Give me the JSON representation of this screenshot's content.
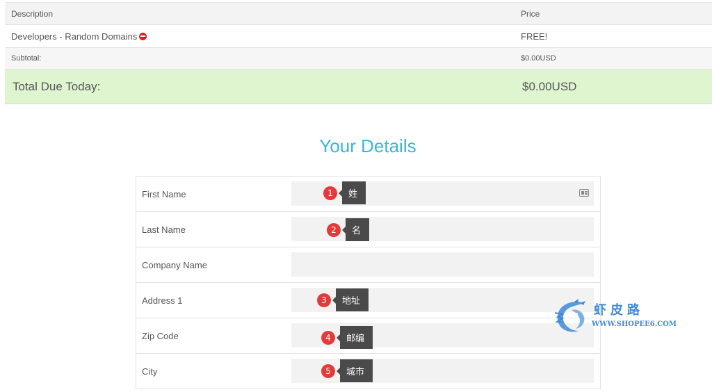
{
  "summary": {
    "headers": {
      "description": "Description",
      "price": "Price"
    },
    "item": {
      "description": "Developers - Random Domains",
      "price": "FREE!"
    },
    "subtotal": {
      "label": "Subtotal:",
      "value": "$0.00USD"
    },
    "total": {
      "label": "Total Due Today:",
      "value": "$0.00USD"
    }
  },
  "details": {
    "title": "Your Details",
    "fields": [
      {
        "label": "First Name",
        "value": ""
      },
      {
        "label": "Last Name",
        "value": ""
      },
      {
        "label": "Company Name",
        "value": ""
      },
      {
        "label": "Address 1",
        "value": ""
      },
      {
        "label": "Zip Code",
        "value": ""
      },
      {
        "label": "City",
        "value": ""
      }
    ]
  },
  "annotations": [
    {
      "number": "1",
      "text": "姓"
    },
    {
      "number": "2",
      "text": "名"
    },
    {
      "number": "3",
      "text": "地址"
    },
    {
      "number": "4",
      "text": "邮编"
    },
    {
      "number": "5",
      "text": "城市"
    }
  ],
  "watermark": {
    "name": "虾皮路",
    "url": "WWW.SHOPEE6.COM"
  },
  "colors": {
    "accent": "#3ab5d8",
    "total_background": "#dff5d0",
    "annotation_badge": "#e33b3b",
    "annotation_tag": "#4a4a4a",
    "remove_icon": "#d9201c",
    "watermark": "#3f8ad6"
  },
  "icons": {
    "remove": "remove-circle-icon",
    "autofill": "contact-card-icon",
    "watermark_logo": "dragon-logo"
  }
}
